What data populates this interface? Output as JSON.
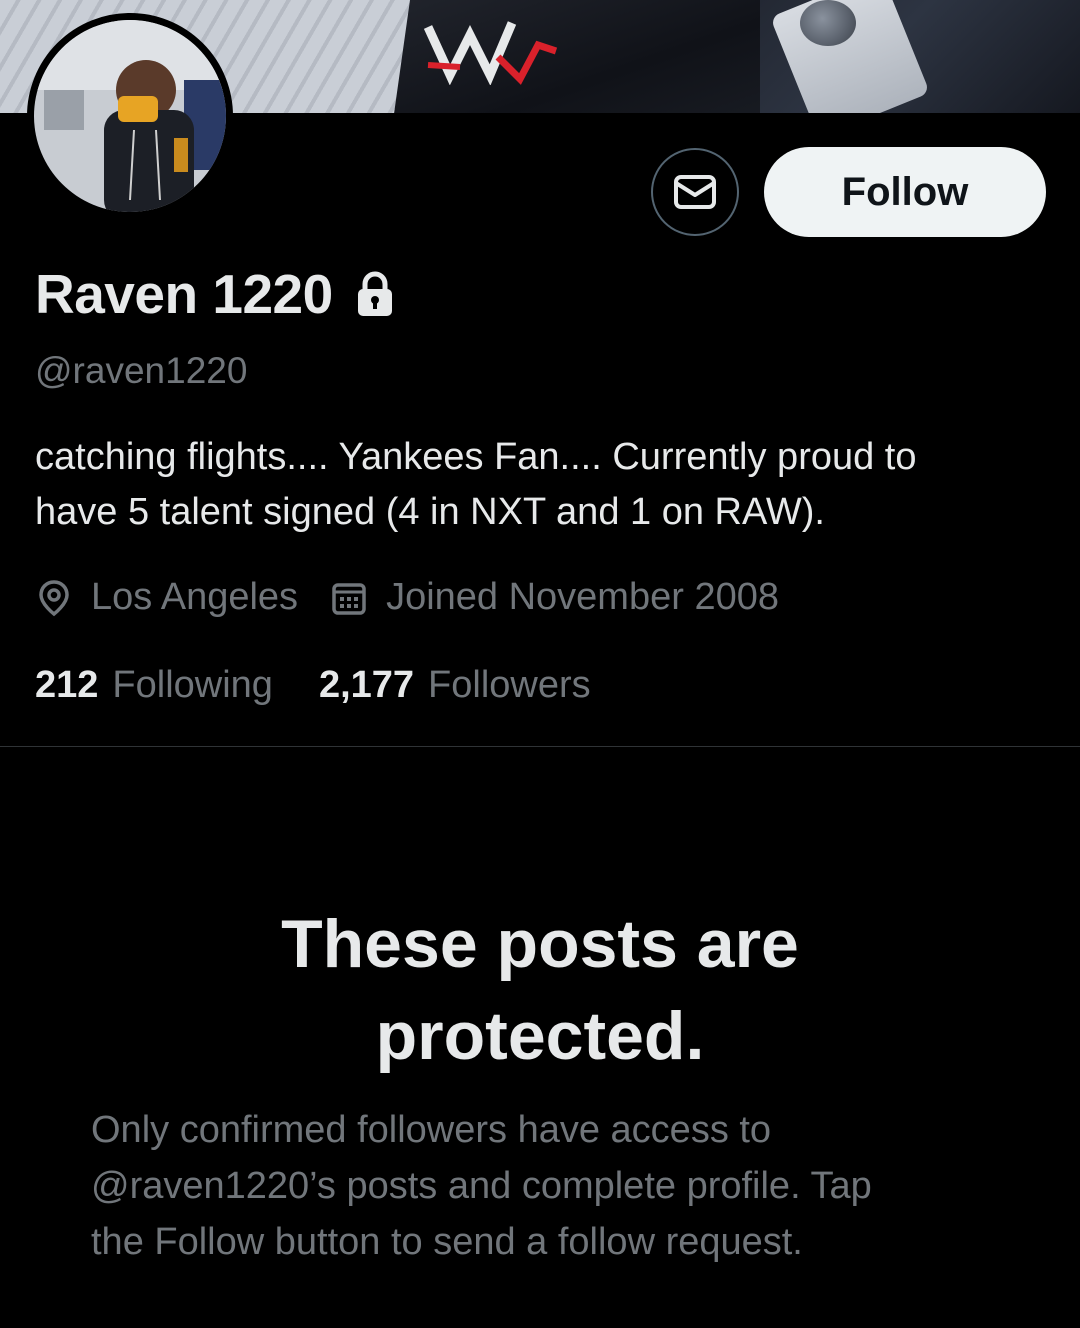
{
  "profile": {
    "display_name": "Raven 1220",
    "handle": "@raven1220",
    "bio_line1": "catching flights....  Yankees Fan....  Currently proud to",
    "bio_line2": "have 5 talent signed (4 in NXT and 1 on RAW).",
    "location": "Los Angeles",
    "joined": "Joined November 2008",
    "following_count": "212",
    "following_label": "Following",
    "followers_count": "2,177",
    "followers_label": "Followers"
  },
  "actions": {
    "follow_label": "Follow",
    "message_icon": "envelope-icon"
  },
  "protected": {
    "title_line1": "These posts are",
    "title_line2": "protected.",
    "body_line1": "Only confirmed followers have access to",
    "body_line2": "@raven1220’s posts and complete profile. Tap",
    "body_line3": "the Follow button to send a follow request."
  },
  "icons": {
    "lock": "lock-icon",
    "location": "location-pin-icon",
    "calendar": "calendar-icon"
  },
  "colors": {
    "background": "#000000",
    "primary_text": "#e7e9ea",
    "secondary_text": "#71767b",
    "follow_button_bg": "#eff3f4",
    "follow_button_text": "#0f1419",
    "divider": "#2f3336"
  }
}
